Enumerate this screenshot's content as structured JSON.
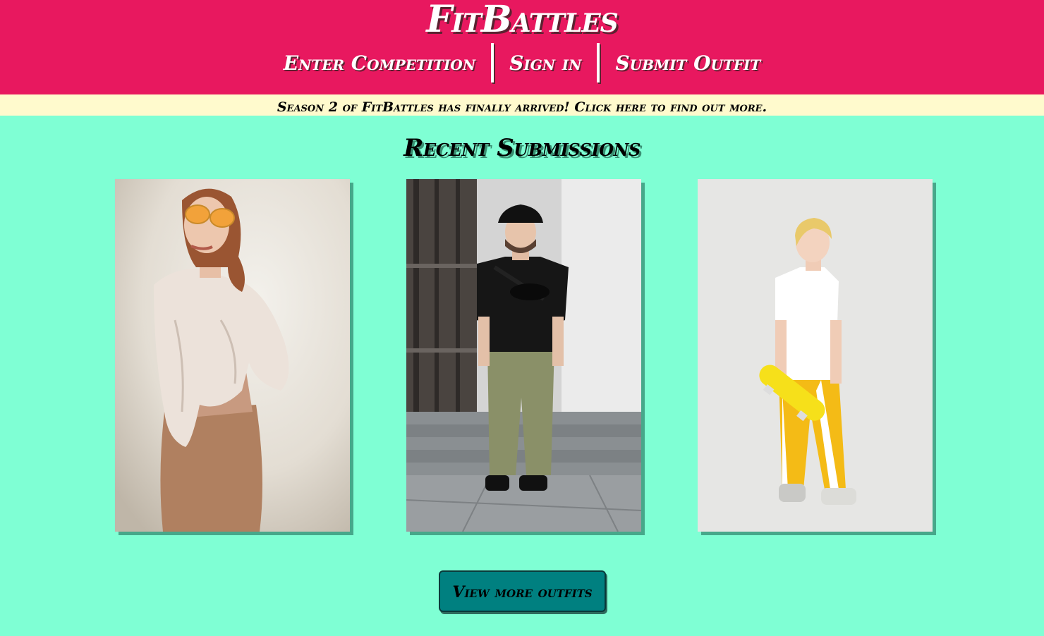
{
  "header": {
    "logo": "FitBattles",
    "nav": [
      {
        "label": "Enter Competition"
      },
      {
        "label": "Sign in"
      },
      {
        "label": "Submit Outfit"
      }
    ]
  },
  "announcement": {
    "text": "Season 2 of FitBattles has finally arrived! Click here to find out more."
  },
  "main": {
    "title": "Recent Submissions",
    "submissions": [
      {
        "image": "woman-orange-sunglasses-white-jacket-photo"
      },
      {
        "image": "man-bucket-hat-black-tshirt-stairs-photo"
      },
      {
        "image": "blond-teen-white-tshirt-yellow-pants-skateboard-photo"
      }
    ],
    "more_button": "View more outfits"
  },
  "colors": {
    "header_bg": "#e8185f",
    "announcement_bg": "#fffacd",
    "page_bg": "#7fffd4",
    "button_bg": "#008080"
  }
}
